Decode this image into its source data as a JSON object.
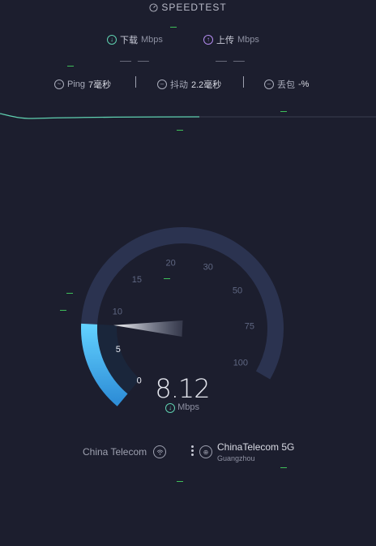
{
  "header": {
    "title": "SPEEDTEST"
  },
  "download": {
    "label": "下载",
    "unit": "Mbps",
    "value": "— —"
  },
  "upload": {
    "label": "上传",
    "unit": "Mbps",
    "value": "— —"
  },
  "stats": {
    "ping_label": "Ping",
    "ping_value": "7毫秒",
    "jitter_label": "抖动",
    "jitter_value": "2.2毫秒",
    "loss_label": "丢包",
    "loss_value": "-%"
  },
  "gauge": {
    "ticks": [
      "0",
      "5",
      "10",
      "15",
      "20",
      "30",
      "50",
      "75",
      "100"
    ],
    "speed": "8.12",
    "unit": "Mbps",
    "level_mbps": 8.12
  },
  "connection": {
    "isp": "China Telecom",
    "server_name": "ChinaTelecom 5G",
    "server_city": "Guangzhou"
  },
  "colors": {
    "background": "#1c1e2e",
    "arc_track": "#2b3350",
    "arc_fill": "#4fc3f7",
    "download_accent": "#5fd0b0",
    "upload_accent": "#b48cf0"
  }
}
